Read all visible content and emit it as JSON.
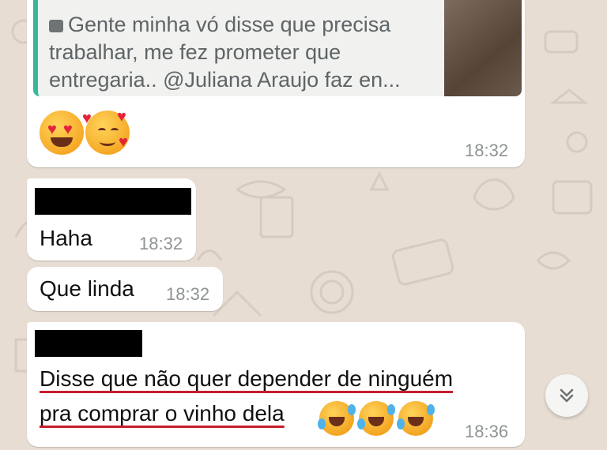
{
  "chat": {
    "quoted_message": {
      "icon": "photo-icon",
      "text": "Gente minha vó disse que precisa trabalhar, me fez prometer que entregaria.. @Juliana Araujo faz en..."
    },
    "messages": [
      {
        "text": "😍🥰",
        "time": "18:32"
      },
      {
        "text": "Haha",
        "time": "18:32"
      },
      {
        "text": "Que linda",
        "time": "18:32"
      },
      {
        "line1": "Disse que não quer depender de ninguém",
        "line2": "pra comprar o vinho dela",
        "emoji": "🤣🤣🤣",
        "time": "18:36"
      }
    ],
    "scroll_button_icon": "double-chevron-down-icon"
  },
  "colors": {
    "chat_background": "#e7ddd3",
    "bubble": "#ffffff",
    "quote_bar": "#35b99a",
    "underline": "#c61e2c"
  }
}
